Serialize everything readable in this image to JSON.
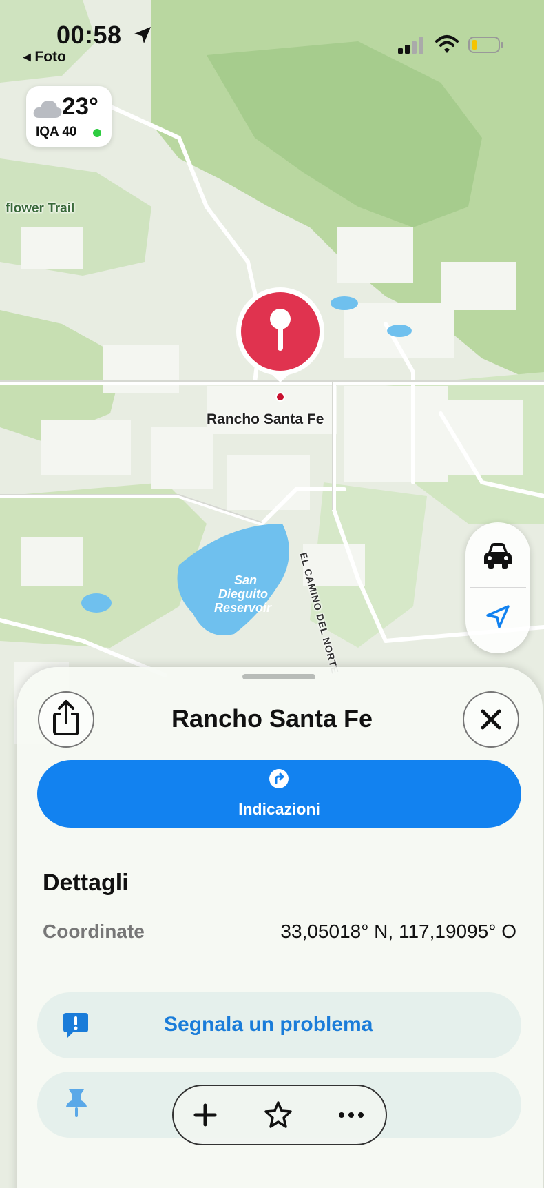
{
  "status_bar": {
    "time": "00:58",
    "back_label": "◂ Foto"
  },
  "weather": {
    "temperature": "23°",
    "aqi_label": "IQA 40",
    "aqi_color": "#2ecc40"
  },
  "map": {
    "labels": {
      "trail": "flower Trail",
      "reservoir_line1": "San",
      "reservoir_line2": "Dieguito",
      "reservoir_line3": "Reservoir",
      "road": "EL CAMINO DEL NORTE"
    },
    "pin_label": "Rancho Santa Fe",
    "pin_color": "#e0334f"
  },
  "map_controls": {
    "drive_icon": "car-icon",
    "location_icon": "location-arrow-icon"
  },
  "sheet": {
    "title": "Rancho Santa Fe",
    "directions_label": "Indicazioni",
    "details_title": "Dettagli",
    "coord_label": "Coordinate",
    "coord_value": "33,05018° N, 117,19095° O",
    "report_label": "Segnala un problema",
    "accent_color": "#1282f0"
  },
  "toolbar": {
    "items": [
      "plus-icon",
      "star-icon",
      "ellipsis-icon"
    ]
  }
}
